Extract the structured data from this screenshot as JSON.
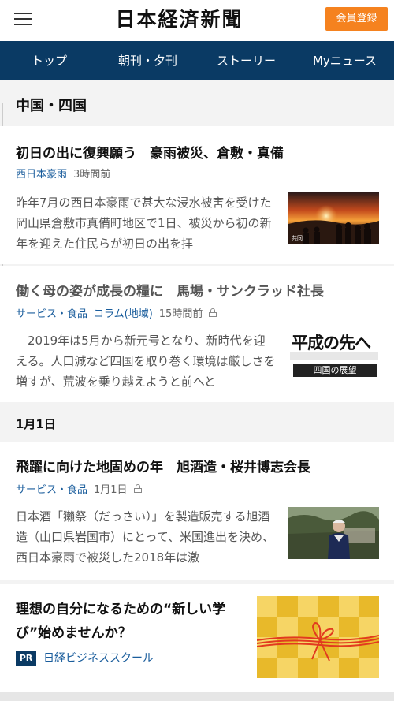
{
  "header": {
    "logo": "日本経済新聞",
    "member_button": "会員登録"
  },
  "nav": {
    "items": [
      "トップ",
      "朝刊・夕刊",
      "ストーリー",
      "Myニュース"
    ]
  },
  "section": {
    "region": "中国・四国",
    "date": "1月1日"
  },
  "articles": [
    {
      "title": "初日の出に復興願う　豪雨被災、倉敷・真備",
      "tags": [
        "西日本豪雨"
      ],
      "time": "3時間前",
      "locked": false,
      "summary": "昨年7月の西日本豪雨で甚大な浸水被害を受けた岡山県倉敷市真備町地区で1日、被災から初の新年を迎えた住民らが初日の出を拝",
      "photo_credit": "共同"
    },
    {
      "title": "働く母の姿が成長の糧に　馬場・サンクラッド社長",
      "tags": [
        "サービス・食品",
        "コラム(地域)"
      ],
      "time": "15時間前",
      "locked": true,
      "summary": "　2019年は5月から新元号となり、新時代を迎える。人口減など四国を取り巻く環境は厳しさを増すが、荒波を乗り越えようと前へと",
      "thumb_title": "平成の先へ",
      "thumb_subtitle": "四国の展望"
    },
    {
      "title": "飛躍に向けた地固めの年　旭酒造・桜井博志会長",
      "tags": [
        "サービス・食品"
      ],
      "time": "1月1日",
      "locked": true,
      "summary": "日本酒「獺祭（だっさい）」を製造販売する旭酒造（山口県岩国市）にとって、米国進出を決め、西日本豪雨で被災した2018年は激"
    }
  ],
  "ad": {
    "title": "理想の自分になるための“新しい学び”始めませんか？",
    "badge": "PR",
    "sponsor": "日経ビジネススクール"
  },
  "colors": {
    "nav_bg": "#0a3a64",
    "accent_orange": "#f5821f",
    "link_blue": "#1a5d9c"
  }
}
